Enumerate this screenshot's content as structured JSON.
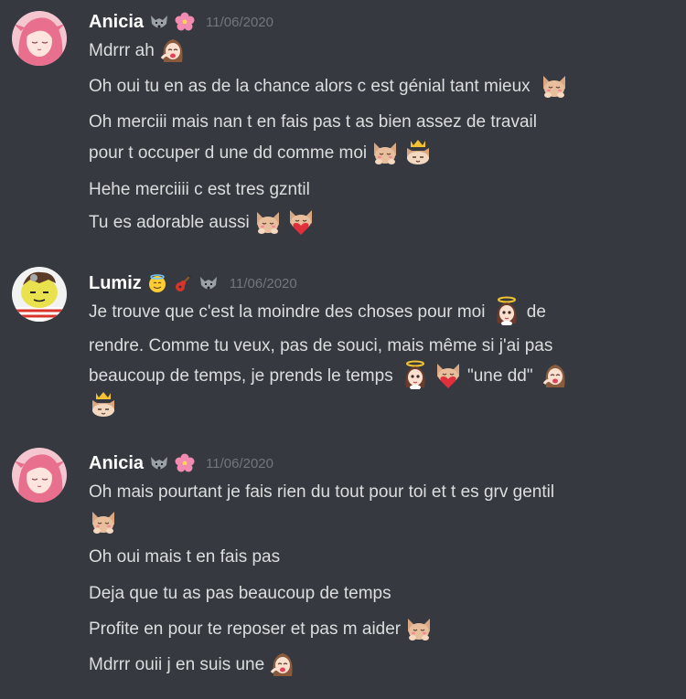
{
  "messages": [
    {
      "author": "Anicia",
      "timestamp": "11/06/2020",
      "badges": [
        "wolf-icon",
        "hibiscus-icon"
      ],
      "lines": [
        {
          "text": "Mdrrr ah",
          "emotes": [
            "girl-laugh-emote"
          ]
        },
        {
          "text": "Oh oui tu en as de la chance alors c est génial tant mieux",
          "emotes": [
            "cat-hug-emote"
          ]
        },
        {
          "text": "Oh merciii mais nan t en fais pas t as bien assez de travail",
          "emotes": []
        },
        {
          "text": "pour t occuper d une dd comme moi",
          "emotes": [
            "cat-hug-emote",
            "cat-crown-emote"
          ]
        },
        {
          "text": "Hehe merciiii c est tres gzntil",
          "emotes": []
        },
        {
          "text": "Tu es adorable aussi",
          "emotes": [
            "cat-hug-emote",
            "cat-heart-emote"
          ]
        }
      ]
    },
    {
      "author": "Lumiz",
      "timestamp": "11/06/2020",
      "badges": [
        "angel-emoji-icon",
        "guitar-icon",
        "wolf-icon"
      ],
      "lines": [
        {
          "text": "Je trouve que c'est la moindre des choses pour moi",
          "emotes": [
            "angel-girl-emote"
          ],
          "after": "de"
        },
        {
          "text": "rendre. Comme tu veux, pas de souci, mais même si j'ai pas",
          "emotes": []
        },
        {
          "text": "beaucoup de temps, je prends le temps",
          "emotes": [
            "angel-girl-emote",
            "cat-heart-emote"
          ],
          "after": "\"une dd\""
        },
        {
          "text": "",
          "emotes": [
            "cat-crown-emote"
          ]
        }
      ]
    },
    {
      "author": "Anicia",
      "timestamp": "11/06/2020",
      "badges": [
        "wolf-icon",
        "hibiscus-icon"
      ],
      "lines": [
        {
          "text": "Oh mais pourtant je fais rien du tout pour toi et t es grv gentil",
          "emotes": []
        },
        {
          "text": "",
          "emotes": [
            "cat-hug-emote"
          ]
        },
        {
          "text": "Oh oui mais t en fais pas",
          "emotes": []
        },
        {
          "text": "Deja que tu as pas beaucoup de temps",
          "emotes": []
        },
        {
          "text": "Profite en pour te reposer et pas m aider",
          "emotes": [
            "cat-hug-emote"
          ]
        },
        {
          "text": "Mdrrr ouii j en suis une",
          "emotes": [
            "girl-laugh-emote"
          ]
        }
      ]
    }
  ],
  "colors": {
    "background": "#36393f",
    "username": "#ffffff",
    "text": "#dcddde",
    "timestamp": "#72767d"
  }
}
